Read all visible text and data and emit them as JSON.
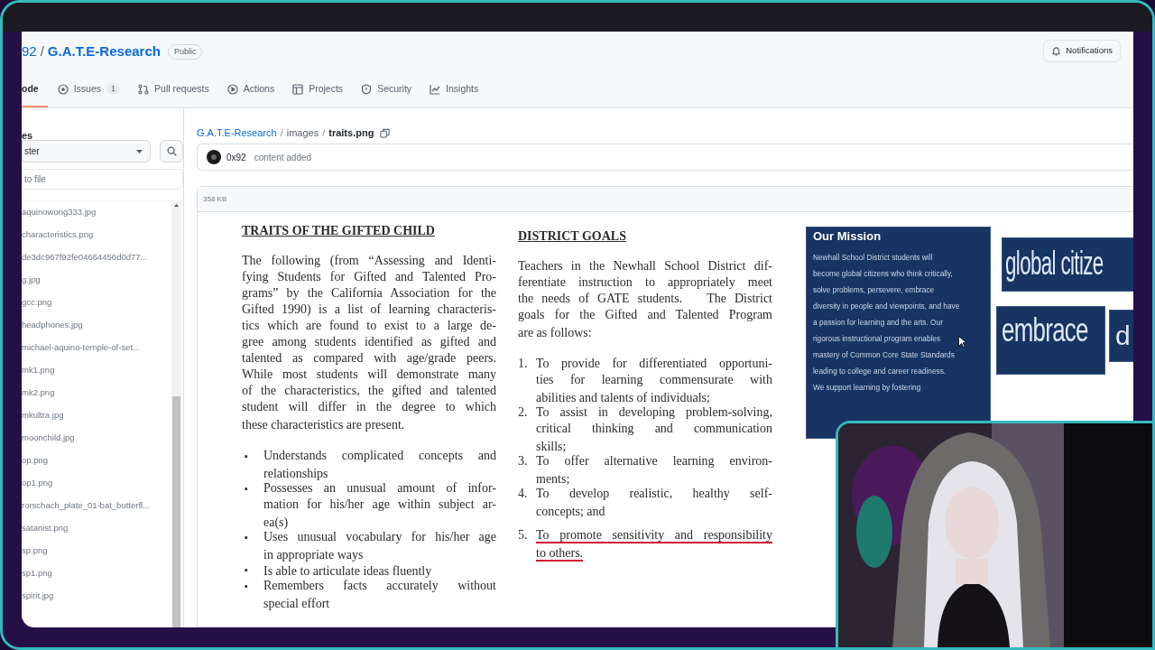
{
  "repo": {
    "owner": "92",
    "separator": "/",
    "name": "G.A.T.E-Research",
    "visibility": "Public"
  },
  "notifications": "Notifications",
  "tabs": [
    {
      "kind": "code",
      "label": "ode",
      "selected": true
    },
    {
      "kind": "issues",
      "label": "Issues",
      "count": "1",
      "selected": false
    },
    {
      "kind": "pulls",
      "label": "Pull requests",
      "selected": false
    },
    {
      "kind": "actions",
      "label": "Actions",
      "selected": false
    },
    {
      "kind": "projects",
      "label": "Projects",
      "selected": false
    },
    {
      "kind": "security",
      "label": "Security",
      "selected": false
    },
    {
      "kind": "insights",
      "label": "Insights",
      "selected": false
    }
  ],
  "sidebar": {
    "heading": "es",
    "branch": "ster",
    "filter_placeholder": "to file",
    "files": [
      "aquinowong333.jpg",
      "characteristics.png",
      "de3dc967f92fe04664456d0d77...",
      "g.jpg",
      "gcc.png",
      "headphones.jpg",
      "michael-aquino-temple-of-set...",
      "mk1.png",
      "mk2.png",
      "mkultra.jpg",
      "moonchild.jpg",
      "op.png",
      "op1.png",
      "rorschach_plate_01-bat_butterfl...",
      "satanist.png",
      "sp.png",
      "sp1.png",
      "spirit.jpg"
    ]
  },
  "breadcrumb": {
    "path": [
      "G.A.T.E-Research",
      "images"
    ],
    "separator": "/",
    "file": "traits.png"
  },
  "commit": {
    "author": "0x92",
    "message": "content added"
  },
  "file_size": "358 KB",
  "document": {
    "traits": {
      "heading": "TRAITS OF THE GIFTED CHILD",
      "lines": [
        "The following (from “Assessing and Identi-",
        "fying Students for Gifted and Talented Pro-",
        "grams” by the California Association for the",
        "Gifted 1990) is a list of learning characteris-",
        "tics which are found to exist to a large de-",
        "gree among students identified as gifted and",
        "talented as compared with age/grade peers.",
        "While most students will demonstrate many",
        "of the characteristics, the gifted and talented",
        "student will differ in the degree to which",
        "these characteristics are present."
      ],
      "bullets": [
        {
          "marker": "▪",
          "lines": [
            "Understands complicated concepts and",
            "relationships"
          ]
        },
        {
          "marker": "▪",
          "lines": [
            "Possesses an unusual amount of infor-",
            "mation for his/her age within subject ar-",
            "ea(s)"
          ]
        },
        {
          "marker": "▪",
          "lines": [
            "Uses unusual vocabulary for his/her age",
            "in appropriate ways"
          ]
        },
        {
          "marker": "▪",
          "lines": [
            "Is able to articulate ideas fluently"
          ]
        },
        {
          "marker": "▪",
          "lines": [
            "Remembers facts accurately without",
            "special effort"
          ]
        }
      ]
    },
    "goals": {
      "heading": "DISTRICT GOALS",
      "lines": [
        "Teachers in the Newhall School District dif-",
        "ferentiate instruction to appropriately meet",
        "the needs of GATE students.   The District",
        "goals for the Gifted and Talented Program",
        "are as follows:"
      ],
      "items": [
        {
          "number": "1.",
          "lines": [
            "To provide for differentiated opportuni-",
            "ties for learning commensurate with",
            "abilities and talents of individuals;"
          ],
          "underlined": false
        },
        {
          "number": "2.",
          "lines": [
            "To assist in developing problem-solving,",
            "critical thinking and communication",
            "skills;"
          ],
          "underlined": false
        },
        {
          "number": "3.",
          "lines": [
            "To offer alternative learning environ-",
            "ments;"
          ],
          "underlined": false
        },
        {
          "number": "4.",
          "lines": [
            "To develop realistic, healthy self-",
            "concepts; and"
          ],
          "underlined": false
        },
        {
          "number": "5.",
          "lines": [
            "To promote sensitivity and responsibility",
            "to others."
          ],
          "underlined": true
        }
      ]
    },
    "mission": {
      "title": "Our Mission",
      "lines": [
        "Newhall School District students will",
        "become global citizens who think critically,",
        "solve problems, persevere, embrace",
        "diversity in people and viewpoints, and have",
        "a passion for learning and the arts. Our",
        "rigorous instructional program enables",
        "mastery of Common Core State Standards",
        "leading to college and career readiness.",
        "We support learning by fostering"
      ]
    },
    "word_cloud": [
      "global citize",
      "embrace",
      "d"
    ]
  }
}
